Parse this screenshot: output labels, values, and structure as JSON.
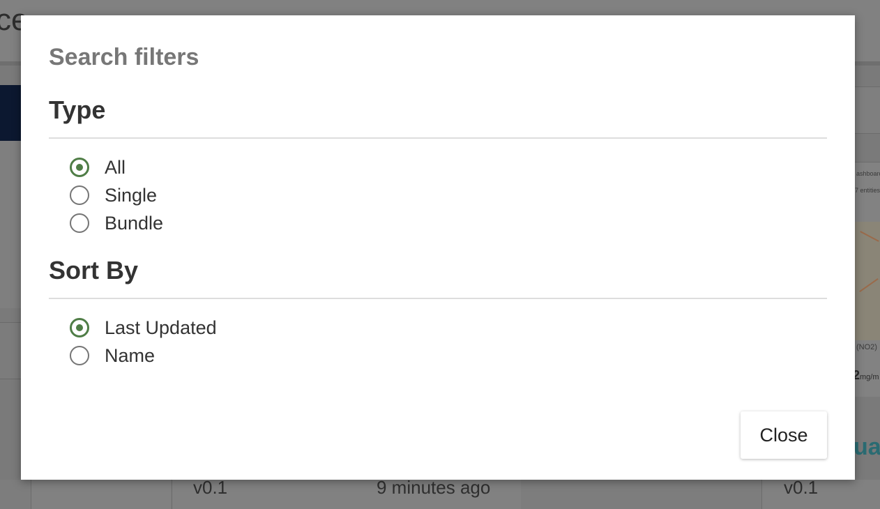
{
  "background": {
    "title_fragment": "ce",
    "right_card_texts": [
      "ashboard",
      "7 entities",
      "(NO2)"
    ],
    "right_value": "2",
    "right_unit": "mg/m",
    "right_link_fragment": "ual",
    "footer": {
      "version_left": "v0.1",
      "updated": "9 minutes ago",
      "version_right": "v0.1"
    }
  },
  "modal": {
    "title": "Search filters",
    "type_section": {
      "heading": "Type",
      "options": [
        {
          "label": "All",
          "checked": true
        },
        {
          "label": "Single",
          "checked": false
        },
        {
          "label": "Bundle",
          "checked": false
        }
      ]
    },
    "sort_section": {
      "heading": "Sort By",
      "options": [
        {
          "label": "Last Updated",
          "checked": true
        },
        {
          "label": "Name",
          "checked": false
        }
      ]
    },
    "close_label": "Close"
  },
  "colors": {
    "radio_accent": "#4f7d46",
    "overlay": "#7a7a7a",
    "title_gray": "#777777"
  }
}
